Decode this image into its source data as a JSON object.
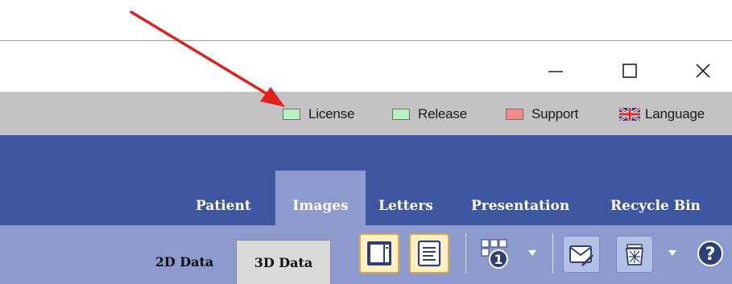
{
  "window_controls": {
    "minimize_icon": "minimize-icon",
    "maximize_icon": "maximize-icon",
    "close_icon": "close-icon"
  },
  "status_bar": {
    "items": [
      {
        "label": "License",
        "color": "#b9f0c3"
      },
      {
        "label": "Release",
        "color": "#b9f0c3"
      },
      {
        "label": "Support",
        "color": "#f28c8c"
      },
      {
        "label": "Language",
        "icon": "uk-flag-icon"
      }
    ]
  },
  "nav": {
    "tabs": [
      {
        "label": "Patient"
      },
      {
        "label": "Images",
        "active": true
      },
      {
        "label": "Letters"
      },
      {
        "label": "Presentation"
      },
      {
        "label": "Recycle Bin"
      }
    ]
  },
  "toolbar": {
    "subtabs": [
      {
        "label": "2D Data"
      },
      {
        "label": "3D Data",
        "active": true
      }
    ],
    "buttons": [
      {
        "icon": "panel-layout-icon",
        "selected": true
      },
      {
        "icon": "document-lines-icon",
        "selected": true
      },
      {
        "icon": "numbering-icon",
        "has_dropdown": true
      },
      {
        "icon": "send-message-icon"
      },
      {
        "icon": "trash-icon",
        "has_dropdown": true
      },
      {
        "icon": "help-icon"
      }
    ]
  },
  "colors": {
    "nav_bar": "#3f57a0",
    "active_tab": "#8c9acd",
    "toolbar": "#8c9acd",
    "status_bar": "#c3c3c3",
    "annotation_arrow": "#e0201b"
  }
}
